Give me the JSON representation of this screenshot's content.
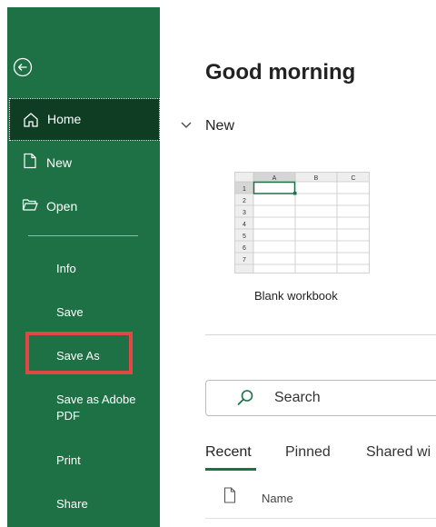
{
  "window": {
    "colors": {
      "sidebar": "#1e7145",
      "sidebar_selected": "#0f3d24",
      "highlight_box": "#e04848",
      "tab_active": "#1e7145"
    }
  },
  "sidebar": {
    "back_icon": "back-arrow-circle-icon",
    "items": [
      {
        "label": "Home",
        "icon": "home-icon"
      },
      {
        "label": "New",
        "icon": "new-document-icon"
      },
      {
        "label": "Open",
        "icon": "open-folder-icon"
      }
    ],
    "plain_items": [
      {
        "label": "Info"
      },
      {
        "label": "Save"
      },
      {
        "label": "Save As"
      },
      {
        "label": "Save as Adobe PDF"
      },
      {
        "label": "Print"
      },
      {
        "label": "Share"
      }
    ]
  },
  "main": {
    "greeting": "Good morning",
    "new_section": {
      "title": "New",
      "template_label": "Blank workbook"
    },
    "template_grid": {
      "columns": [
        "A",
        "B",
        "C"
      ],
      "rows": [
        "1",
        "2",
        "3",
        "4",
        "5",
        "6",
        "7"
      ]
    },
    "search": {
      "placeholder": "Search"
    },
    "tabs": [
      {
        "label": "Recent"
      },
      {
        "label": "Pinned"
      },
      {
        "label": "Shared wi"
      }
    ],
    "list_header": {
      "name": "Name"
    }
  }
}
